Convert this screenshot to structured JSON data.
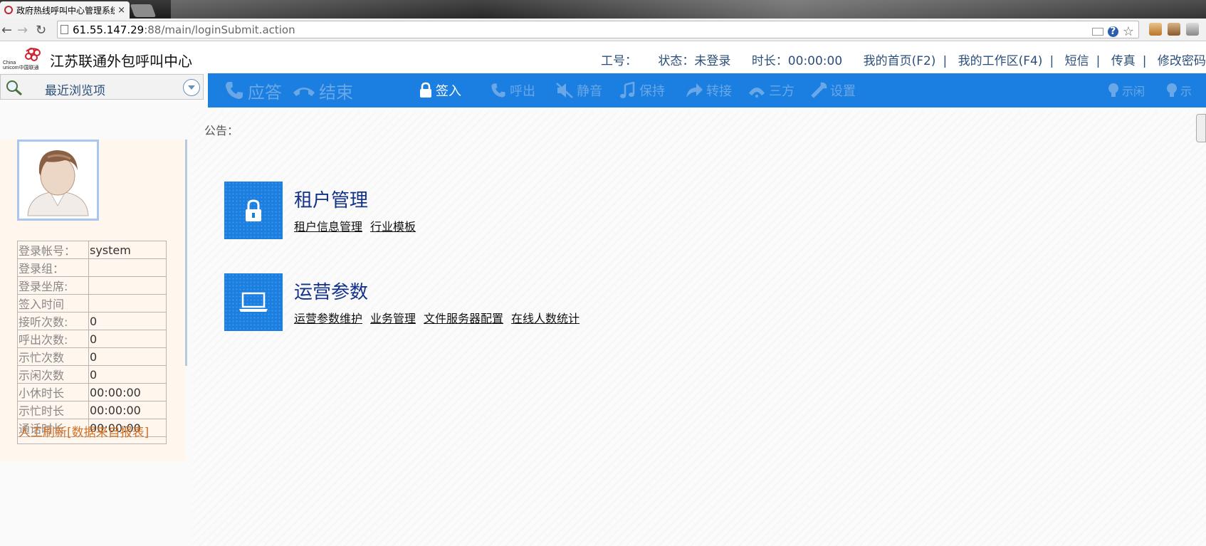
{
  "browser": {
    "tab_title": "政府热线呼叫中心管理系统",
    "tab_close": "×",
    "url_host": "61.55.147.29",
    "url_path": ":88/main/loginSubmit.action",
    "help_glyph": "?",
    "star_glyph": "☆",
    "back_glyph": "←",
    "forward_glyph": "→",
    "reload_glyph": "↻"
  },
  "header": {
    "title": "江苏联通外包呼叫中心",
    "worker_id_label": "工号：",
    "status_label": "状态：未登录",
    "duration_label": "时长：00:00:00",
    "links": [
      "我的首页(F2)",
      "我的工作区(F4)",
      "短信",
      "传真",
      "修改密码"
    ]
  },
  "left_toolbar": {
    "label": "最近浏览项"
  },
  "toolbar": {
    "answer": "应答",
    "hangup": "结束",
    "signin": "签入",
    "callout": "呼出",
    "mute": "静音",
    "hold": "保持",
    "transfer": "转接",
    "three_way": "三方",
    "settings": "设置",
    "idle": "示闲",
    "busy_partial": "示"
  },
  "profile": {
    "rows": [
      {
        "label": "登录帐号：",
        "value": "system"
      },
      {
        "label": "登录组：",
        "value": ""
      },
      {
        "label": "登录坐席:",
        "value": ""
      },
      {
        "label": "签入时间",
        "value": ""
      },
      {
        "label": "接听次数:",
        "value": "0"
      },
      {
        "label": "呼出次数:",
        "value": "0"
      },
      {
        "label": "示忙次数",
        "value": "0"
      },
      {
        "label": "示闲次数",
        "value": "0"
      },
      {
        "label": "小休时长",
        "value": "00:00:00"
      },
      {
        "label": "示忙时长",
        "value": "00:00:00"
      },
      {
        "label": "通话时长",
        "value": "00:00:00"
      }
    ],
    "refresh_text": "人工刷新[数据来自报表]"
  },
  "main": {
    "notice_label": "公告：",
    "modules": [
      {
        "title": "租户管理",
        "icon": "lock-icon",
        "links": [
          "租户信息管理",
          "行业模板"
        ]
      },
      {
        "title": "运营参数",
        "icon": "laptop-icon",
        "links": [
          "运营参数维护",
          "业务管理",
          "文件服务器配置",
          "在线人数统计"
        ]
      }
    ]
  },
  "colors": {
    "toolbar_blue": "#1a7fe0",
    "header_text": "#2b4f7a",
    "module_title": "#12318a",
    "refresh_text": "#d2722a"
  }
}
